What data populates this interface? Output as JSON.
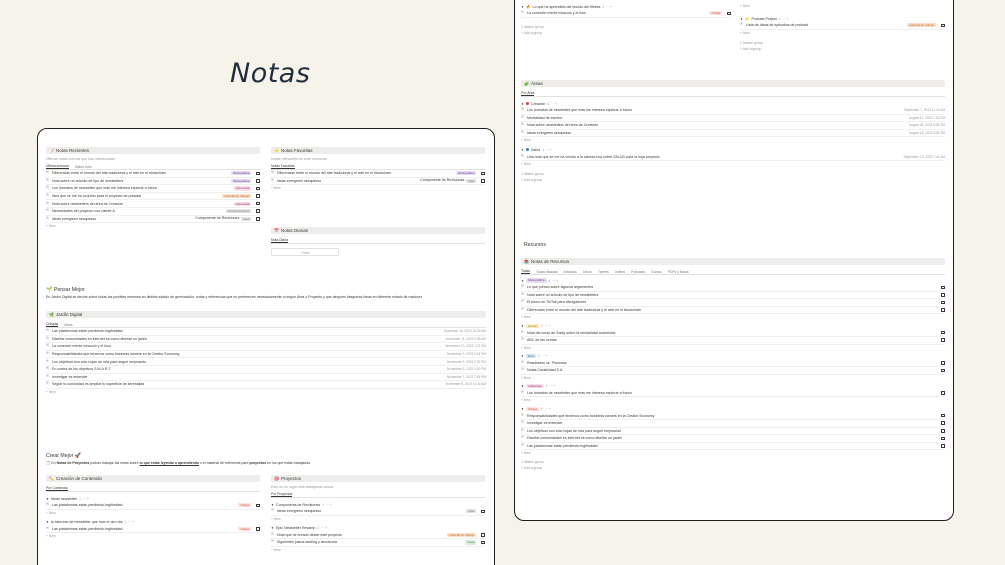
{
  "hero": {
    "title": "Notas"
  },
  "left": {
    "recientes": {
      "title": "Notas Recientes",
      "subtitle": "Últimas notas con las que has interactuado.",
      "tabs": [
        "Última semana",
        "Último mes"
      ],
      "rows": [
        {
          "text": "Diferencias entre el mundo del arte tradicional y el arte en el blockchain",
          "tag": "bibliográfica",
          "tagc": "purple"
        },
        {
          "text": "Nota sobre un artículo de tipo de newsletters",
          "tag": "bibliográfica",
          "tagc": "purple"
        },
        {
          "text": "Los formatos de newsletter que más me interesa explorar a futuro",
          "tag": "referencia",
          "tagc": "pink"
        },
        {
          "text": "Idea que se me ha ocurrido para el proyecto de podcast",
          "tag": "material de trabajo",
          "tagc": "orange"
        },
        {
          "text": "Nota sobre newsletters del área de Creación",
          "tag": "referencia",
          "tagc": "pink"
        },
        {
          "text": "Necesidades del proyecto con cliente A",
          "tag": "conversaciones",
          "tagc": "gray"
        },
        {
          "text": "Ideas evergreen sesquesso",
          "tag": "Idea",
          "tagc": "gray",
          "extra": "Componente de Revisiones"
        }
      ],
      "new": "+ New"
    },
    "favoritas": {
      "title": "Notas Favoritas",
      "subtitle": "Notas relevantes en este momento.",
      "tab": "Notas Favoritas",
      "rows": [
        {
          "text": "Diferencias entre el mundo del arte tradicional y el arte en el blockchain",
          "tag": "bibliográfica",
          "tagc": "purple"
        },
        {
          "text": "Ideas evergreen sesquesso",
          "tag": "Idea",
          "tagc": "gray",
          "extra": "Componente de Revisiones"
        }
      ],
      "new": "+ New"
    },
    "diarias": {
      "title": "Notas Diarias",
      "tab": "Nota Diaria",
      "new": "+ New"
    },
    "pensar": {
      "title": "Pensar Mejor",
      "text": "En Jardín Digital se decide sobre todas las posibles memoria en distinto estado de germinación, notas y referencias que no pertenecen necesariamente a ningún Área o Proyecto y que después integrarás ideas en diferente estado de madurez"
    },
    "jardin": {
      "title": "Jardín Digital",
      "tabs": [
        "Chispas",
        "Ideas"
      ],
      "rows": [
        {
          "text": "Las plataformas están perdiendo legitimidad",
          "date": "November 16, 2023 10:30 AM"
        },
        {
          "text": "Diseñar comunidades en internet es como diseñar un jardín",
          "date": "November 11, 2023 9:55 AM"
        },
        {
          "text": "La conexión mente músculo y el foco",
          "date": "November 10, 2023 7:22 PM"
        },
        {
          "text": "Responsabilidades que tenemos como business owners en la Creator Economy",
          "date": "November 9, 2023 2:44 PM"
        },
        {
          "text": "Los objetivos son sólo hojas de ruta para seguir mejorando",
          "date": "November 9, 2023 2:30 PM"
        },
        {
          "text": "En contra de los objetivos S.M.A.R.T",
          "date": "November 9, 2023 1:20 PM"
        },
        {
          "text": "Investigar es entender",
          "date": "November 7, 2023 7:53 PM"
        },
        {
          "text": "Seguir tu curiosidad es ampliar tu superficie de serendipia",
          "date": "November 6, 2023 11:44 AM"
        }
      ],
      "new": "+ New"
    },
    "crear": {
      "title": "Crear Mejor",
      "text_a": "En",
      "text_b": "Notas de Proyectos",
      "text_c": "podrás trabajar las notas sobre",
      "text_d": "lo que estás leyendo o aprendiendo",
      "text_e": "o el material de referencia para",
      "text_f": "proyectos",
      "text_g": "en los que estás trabajando."
    },
    "creacion": {
      "title": "Creación de Contenido",
      "tab": "Por Contenido",
      "groups": [
        {
          "name": "Ideas newsletter",
          "count": "1",
          "rows": [
            {
              "text": "Las plataformas están perdiendo legitimidad",
              "tag": "chispa",
              "tagc": "red"
            }
          ]
        },
        {
          "name": "la idea eso de newsletter que tuve el otro día",
          "count": "1",
          "rows": [
            {
              "text": "Las plataformas están perdiendo legitimidad",
              "tag": "chispa",
              "tagc": "red"
            }
          ]
        }
      ],
      "new": "+ New"
    },
    "proyectos": {
      "title": "Proyectos",
      "subtitle": "Este es un lugar está trabajando ahora.",
      "tab": "Por Proyectos",
      "groups": [
        {
          "name": "Componente de Revisiones",
          "count": "1",
          "rows": [
            {
              "text": "Ideas evergreen sesquesso",
              "tag": "Idea",
              "tagc": "gray"
            }
          ]
        },
        {
          "name": "Epic Newsletter Revamp",
          "count": "2",
          "rows": [
            {
              "text": "Nota que he creado desde este proyecto",
              "tag": "material de trabajo",
              "tagc": "orange"
            },
            {
              "text": "Siguientes pasos landing y secuencia",
              "tag": "tarea",
              "tagc": "green"
            }
          ]
        }
      ],
      "new": "+ New"
    }
  },
  "right": {
    "top": {
      "group1": "Lo que he aprendido del mundo del fitness",
      "group1_count": "1",
      "row1": "La conexión mente músculo y el foco",
      "row1_tag": "chispa",
      "hidden": "1 hidden group",
      "add": "+ Add a group",
      "new": "+ New",
      "group2": "Podcast Project",
      "group2_count": "1",
      "row2": "Lista de Ideas de episodios de podcast",
      "row2_tag": "material de trabajo",
      "new2": "+ New",
      "hidden2": "1 hidden group",
      "add2": "+ Add a group"
    },
    "areas": {
      "title": "Áreas",
      "tab": "Por Área",
      "groups": [
        {
          "name": "Creación",
          "count": "4",
          "color": "#e03e3e",
          "rows": [
            {
              "text": "Los formatos de newsletter que más me interesa explorar a futuro",
              "date": "September 7, 2023 11:14 AM"
            },
            {
              "text": "Mentalidad de escritor",
              "date": "August 17, 2023 7:16 PM"
            },
            {
              "text": "Nota sobre newsletters del área de Creación",
              "date": "August 28, 2023 8:35 PM"
            },
            {
              "text": "Ideas evergreen sesquesso",
              "date": "August 18, 2023 3:06 PM"
            }
          ]
        },
        {
          "name": "Salud",
          "count": "1",
          "color": "#2f80c7",
          "rows": [
            {
              "text": "Una nota que se me ha venido a la cabeza hoy sobre SALUD para la hoja proyecto",
              "date": "September 13, 2023 7:41 AM"
            }
          ]
        }
      ],
      "new": "+ New",
      "hidden": "1 hidden group",
      "add": "+ Add a group"
    },
    "recursos_heading": "Recursos",
    "recursos": {
      "title": "Notas de Recursos",
      "tabs": [
        "Todas",
        "Todas listadas",
        "Artículos",
        "Libros",
        "Tweets",
        "Videos",
        "Podcasts",
        "Cursos",
        "PDFs y Notas"
      ],
      "groups": [
        {
          "name": "bibliográfica",
          "count": "4",
          "tagc": "purple",
          "rows": [
            "Lo que pienso sobre algunos argumentos",
            "Nota sobre un artículo de tipo de newsletters",
            "El futuro en TikTok para divulgadores",
            "Diferencias entre el mundo del arte tradicional y el arte en el blockchain"
          ]
        },
        {
          "name": "cursos",
          "count": "2",
          "tagc": "yellow",
          "rows": [
            "Nota del curso de Sonty sobre la mentalidad automotriz",
            "ABC de las ventas"
          ]
        },
        {
          "name": "libro",
          "count": "2",
          "tagc": "blue",
          "rows": [
            "Resultados vs. Procesos",
            "Notas Creatividad S.A"
          ]
        },
        {
          "name": "referencia",
          "count": "1",
          "tagc": "pink",
          "rows": [
            "Los formatos de newsletter que más me interesa explorar a futuro"
          ]
        },
        {
          "name": "chispa",
          "count": "5",
          "tagc": "red",
          "rows": [
            "Responsabilidades que tenemos como business owners en la Creator Economy",
            "Investigar es entender",
            "Los objetivos son sólo hojas de ruta para seguir mejorando",
            "Diseñar comunidades en internet es como diseñar un jardín",
            "Las plataformas están perdiendo legitimidad"
          ]
        }
      ],
      "new": "+ New",
      "hidden": "1 hidden group",
      "add": "+ Add a group"
    }
  }
}
